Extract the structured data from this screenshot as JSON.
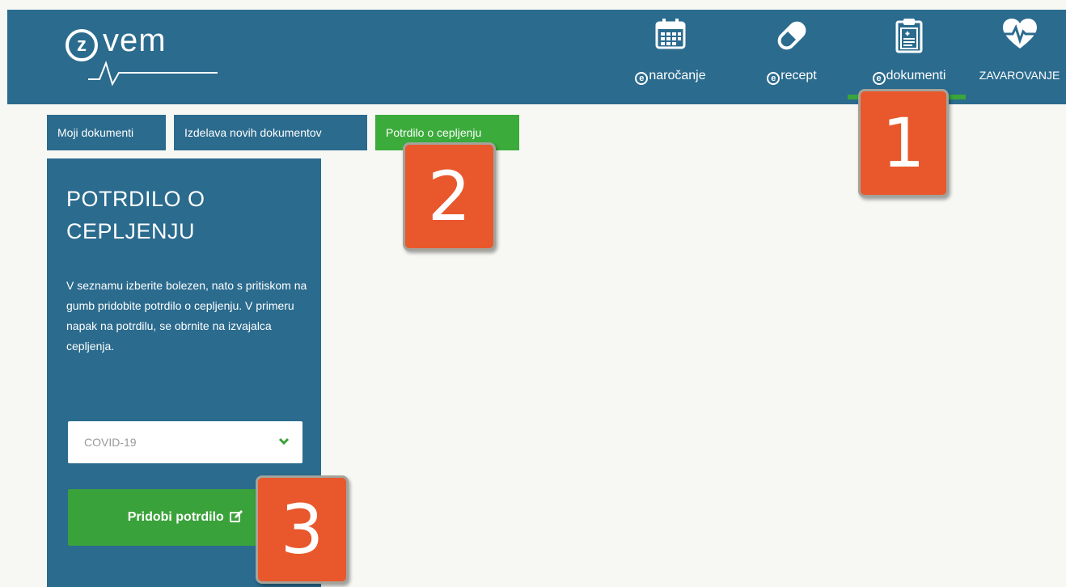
{
  "header": {
    "logo_z": "z",
    "logo_word": "vem",
    "nav": [
      {
        "prefix": "e",
        "label": "naročanje",
        "icon": "calendar-icon"
      },
      {
        "prefix": "e",
        "label": "recept",
        "icon": "pill-icon"
      },
      {
        "prefix": "e",
        "label": "dokumenti",
        "icon": "clipboard-icon"
      },
      {
        "prefix": "",
        "label": "ZAVAROVANJE",
        "icon": "heart-pulse-icon"
      }
    ]
  },
  "tabs": [
    {
      "label": "Moji dokumenti",
      "active": false
    },
    {
      "label": "Izdelava novih dokumentov",
      "active": false
    },
    {
      "label": "Potrdilo o cepljenju",
      "active": true
    }
  ],
  "panel": {
    "title_line1": "POTRDILO O",
    "title_line2": "CEPLJENJU",
    "description": "V seznamu izberite bolezen, nato s pritiskom na gumb pridobite potrdilo o cepljenju. V primeru napak na potrdilu, se obrnite na izvajalca cepljenja.",
    "select_value": "COVID-19",
    "button_label": "Pridobi potrdilo"
  },
  "markers": [
    "1",
    "2",
    "3"
  ],
  "colors": {
    "header_blue": "#2b6b8e",
    "green": "#3aa23a",
    "marker_orange": "#e8582c",
    "background": "#f7f8f4"
  }
}
